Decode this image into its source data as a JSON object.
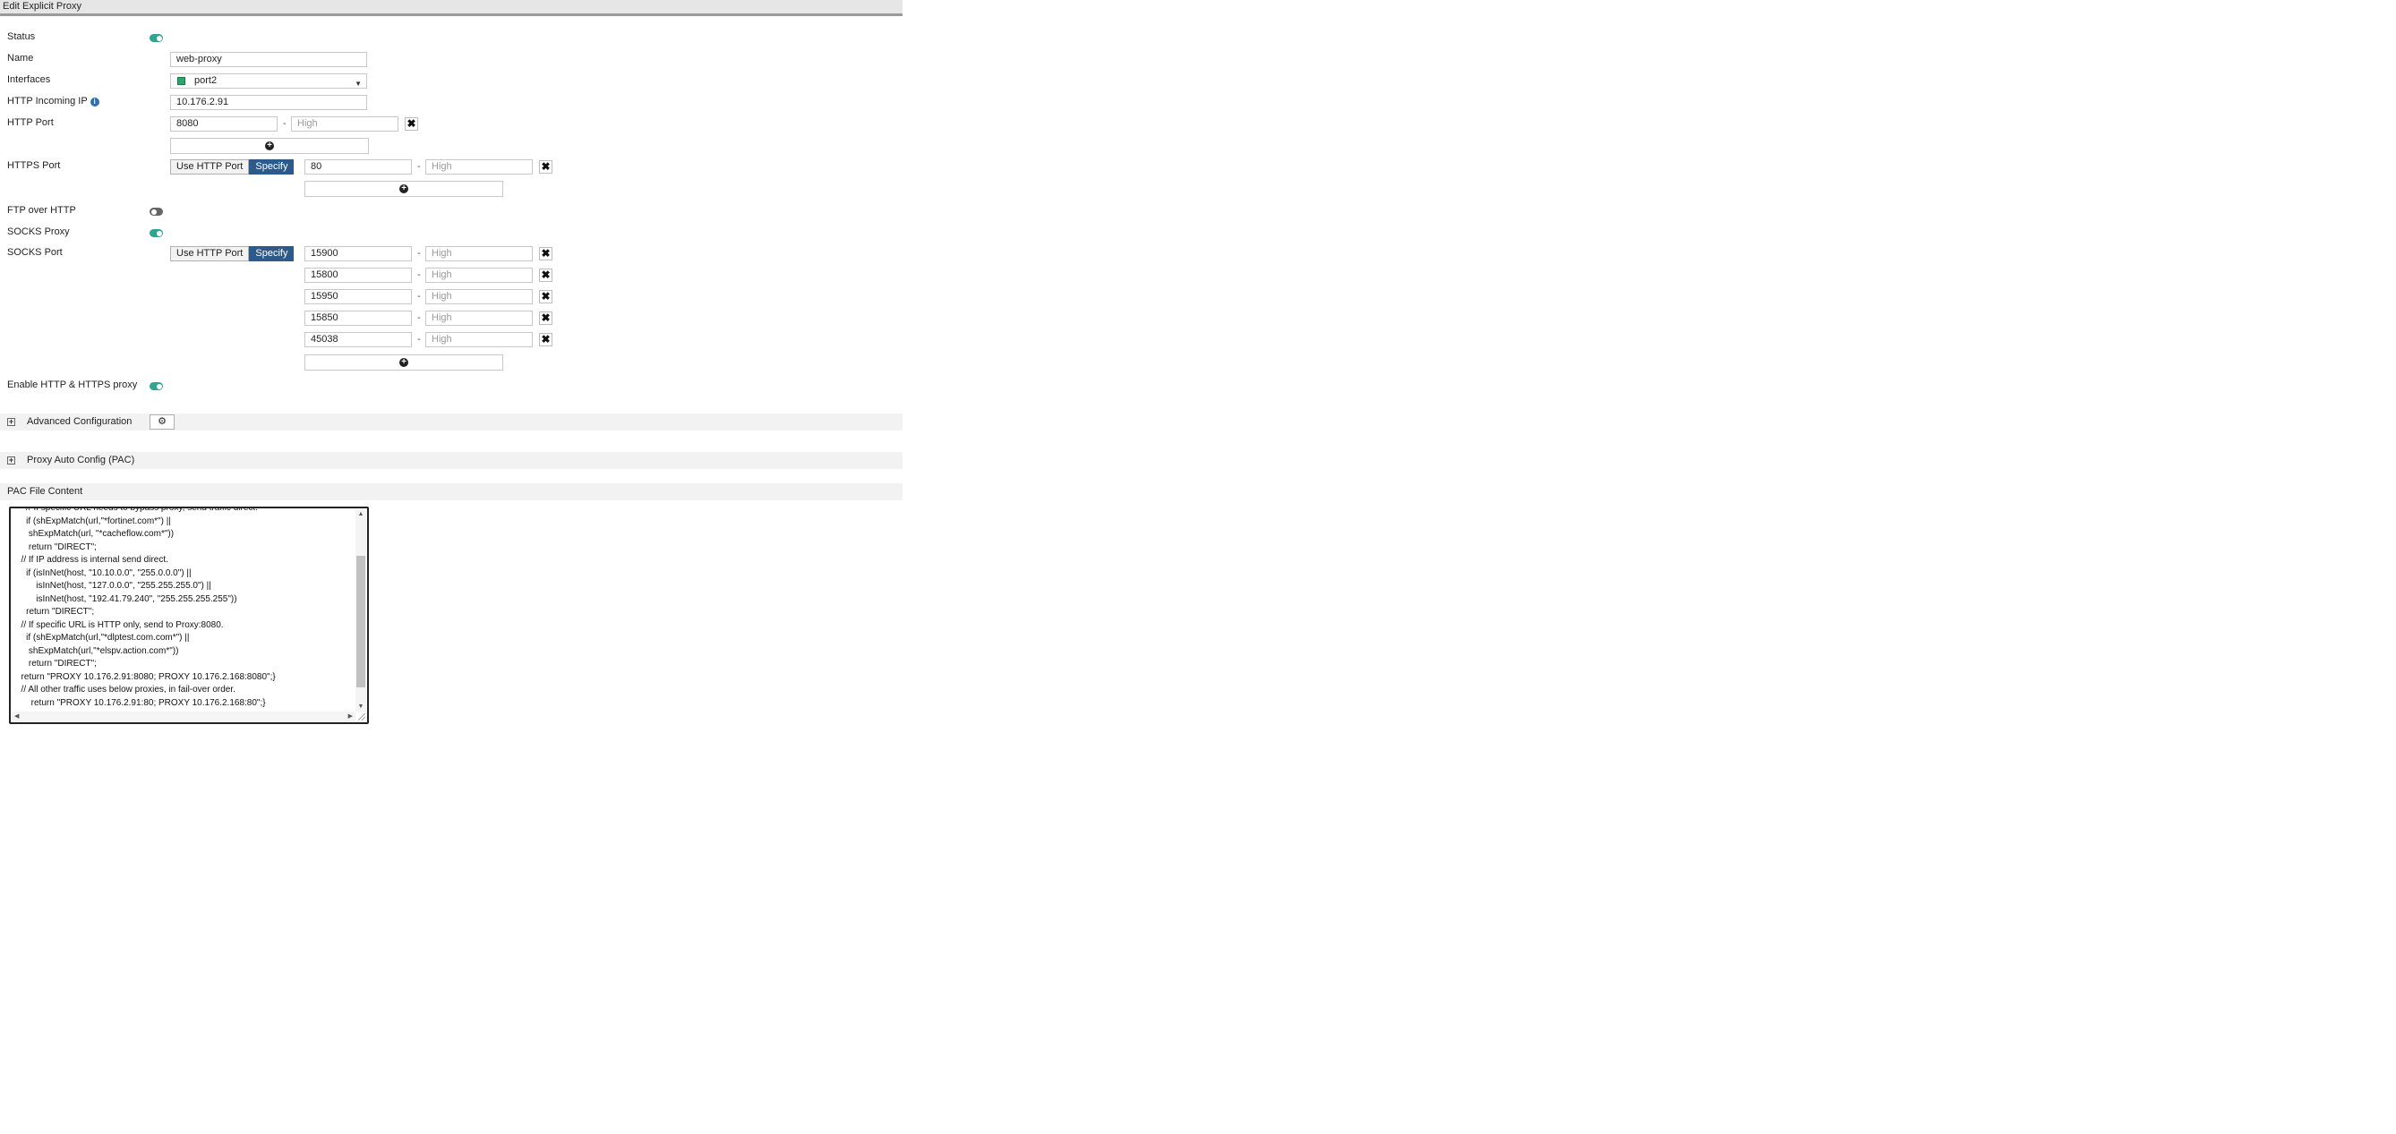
{
  "title": "Edit Explicit Proxy",
  "labels": {
    "status": "Status",
    "name": "Name",
    "interfaces": "Interfaces",
    "http_incoming_ip": "HTTP Incoming IP",
    "http_port": "HTTP Port",
    "https_port": "HTTPS Port",
    "ftp_over_http": "FTP over HTTP",
    "socks_proxy": "SOCKS Proxy",
    "socks_port": "SOCKS Port",
    "enable_http_https": "Enable HTTP & HTTPS proxy"
  },
  "toggles": {
    "status": true,
    "ftp_over_http": false,
    "socks_proxy": true,
    "enable_http_https": true
  },
  "fields": {
    "name": "web-proxy",
    "interface": "port2",
    "http_incoming_ip": "10.176.2.91",
    "http_port_low": "8080",
    "high_placeholder": "High",
    "https_port_low": "80"
  },
  "port_mode": {
    "use_http_port": "Use HTTP Port",
    "specify": "Specify"
  },
  "socks_ports": [
    "15900",
    "15800",
    "15950",
    "15850",
    "45038"
  ],
  "range_separator": "-",
  "remove_glyph": "✖",
  "add_glyph": "+",
  "sections": {
    "advanced": "Advanced Configuration",
    "pac": "Proxy Auto Config (PAC)",
    "pac_content": "PAC File Content"
  },
  "icons": {
    "status_toggle": "toggle-icon",
    "info": "info-icon",
    "interface": "port-icon",
    "advanced_button": "settings-icon",
    "expand": "plus-box-icon",
    "remove": "close-icon",
    "add": "plus-circle-icon",
    "info_glyph": "i",
    "expand_glyph": "+",
    "settings_glyph": "⚙",
    "caret_glyph": "▼",
    "scroll_up": "▲",
    "scroll_down": "▼",
    "scroll_left": "◀",
    "scroll_right": "▶"
  },
  "colors": {
    "toggle_on": "#2fa48f",
    "specify_active": "#2c5a8a"
  },
  "pac_code": "    // If specific URL needs to bypass proxy, send traffic direct.\n    if (shExpMatch(url,\"*fortinet.com*\") ||\n     shExpMatch(url, \"*cacheflow.com*\"))\n     return \"DIRECT\";\n  // If IP address is internal send direct.\n    if (isInNet(host, \"10.10.0.0\", \"255.0.0.0\") ||\n        isInNet(host, \"127.0.0.0\", \"255.255.255.0\") ||\n        isInNet(host, \"192.41.79.240\", \"255.255.255.255\"))\n    return \"DIRECT\";\n  // If specific URL is HTTP only, send to Proxy:8080.\n    if (shExpMatch(url,\"*dlptest.com.com*\") ||\n     shExpMatch(url,\"*elspv.action.com*\"))\n     return \"DIRECT\";\n  return \"PROXY 10.176.2.91:8080; PROXY 10.176.2.168:8080\";}\n  // All other traffic uses below proxies, in fail-over order.\n      return \"PROXY 10.176.2.91:80; PROXY 10.176.2.168:80\";}"
}
